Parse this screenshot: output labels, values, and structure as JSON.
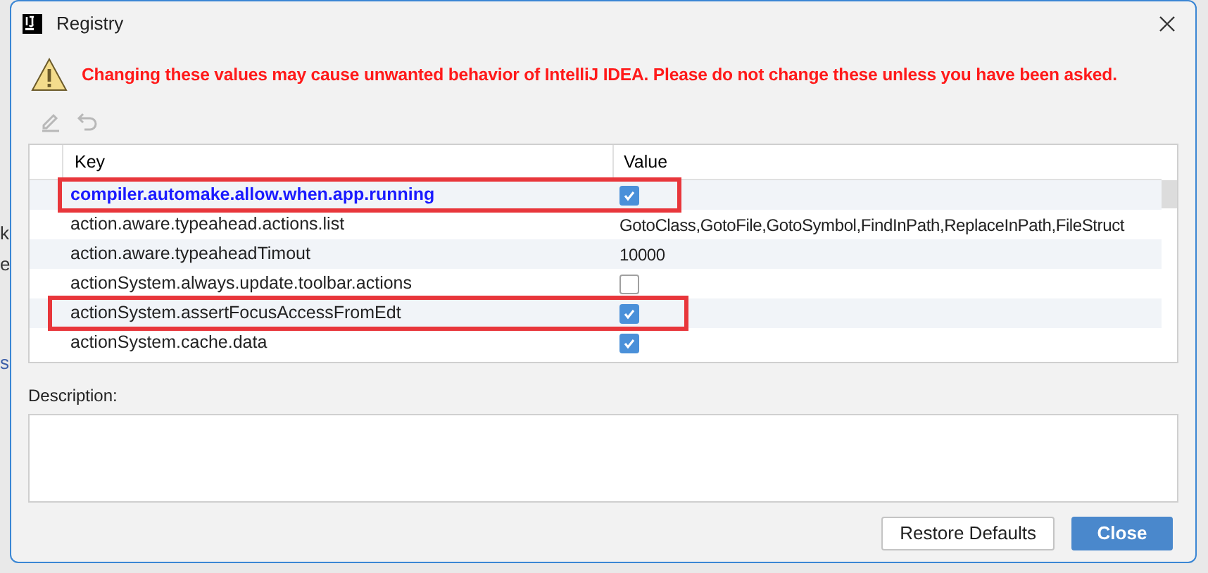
{
  "background_window": {
    "texts": [
      "k",
      "e",
      "s"
    ]
  },
  "window": {
    "title": "Registry"
  },
  "warning": "Changing these values may cause unwanted behavior of IntelliJ IDEA. Please do not change these unless you have been asked.",
  "toolbar": [
    {
      "kind": "edit",
      "disabled": true
    },
    {
      "kind": "revert",
      "disabled": true
    }
  ],
  "table": {
    "columns": [
      "Key",
      "Value"
    ],
    "rows": [
      {
        "key": "compiler.automake.allow.when.app.running",
        "modified": true,
        "highlighted": true,
        "value": {
          "kind": "checkbox",
          "checked": true
        }
      },
      {
        "key": "action.aware.typeahead.actions.list",
        "modified": false,
        "highlighted": false,
        "value": {
          "kind": "text",
          "text": "GotoClass,GotoFile,GotoSymbol,FindInPath,ReplaceInPath,FileStruct"
        }
      },
      {
        "key": "action.aware.typeaheadTimout",
        "modified": false,
        "highlighted": false,
        "value": {
          "kind": "text",
          "text": "10000"
        }
      },
      {
        "key": "actionSystem.always.update.toolbar.actions",
        "modified": false,
        "highlighted": false,
        "value": {
          "kind": "checkbox",
          "checked": false
        }
      },
      {
        "key": "actionSystem.assertFocusAccessFromEdt",
        "modified": false,
        "highlighted": true,
        "value": {
          "kind": "checkbox",
          "checked": true
        }
      },
      {
        "key": "actionSystem.cache.data",
        "modified": false,
        "highlighted": false,
        "value": {
          "kind": "checkbox",
          "checked": true
        }
      }
    ]
  },
  "description": {
    "label": "Description:"
  },
  "buttons": [
    {
      "label": "Restore Defaults",
      "primary": false
    },
    {
      "label": "Close",
      "primary": true
    }
  ]
}
